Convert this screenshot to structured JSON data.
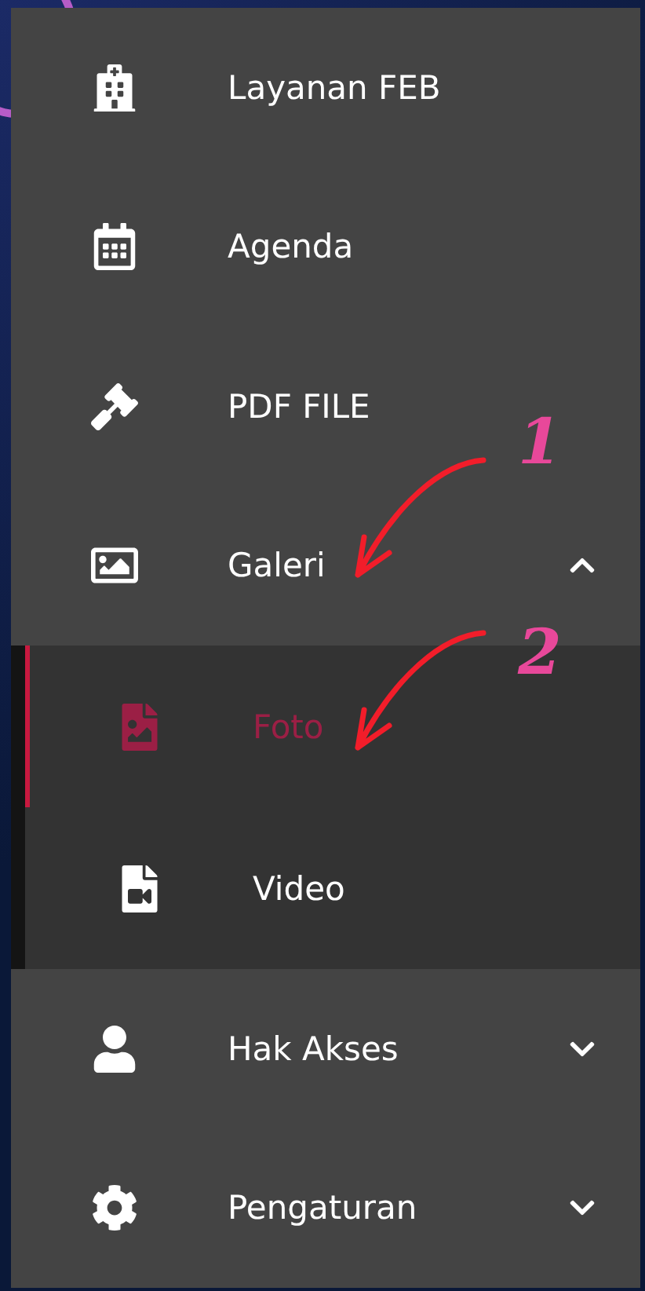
{
  "menu": [
    {
      "kind": "link",
      "label": "Layanan FEB"
    },
    {
      "kind": "link",
      "label": "Agenda"
    },
    {
      "kind": "link",
      "label": "PDF FILE"
    },
    {
      "kind": "group",
      "label": "Galeri",
      "expanded": true,
      "children": [
        {
          "label": "Foto",
          "selected": true
        },
        {
          "label": "Video",
          "selected": false
        }
      ]
    },
    {
      "kind": "group",
      "label": "Hak Akses",
      "expanded": false
    },
    {
      "kind": "group",
      "label": "Pengaturan",
      "expanded": false
    }
  ],
  "annotations": [
    {
      "label": "1"
    },
    {
      "label": "2"
    }
  ]
}
